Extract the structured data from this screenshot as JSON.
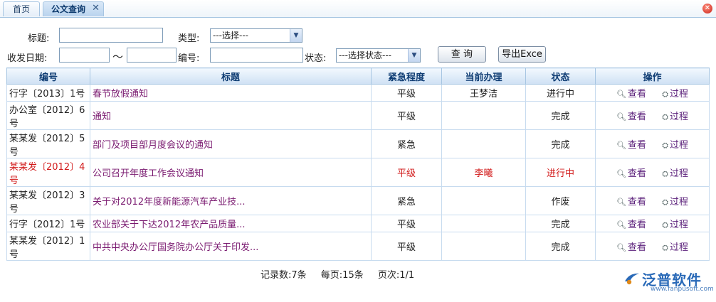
{
  "tabs": [
    {
      "label": "首页",
      "active": false
    },
    {
      "label": "公文查询",
      "active": true,
      "close": "✕"
    }
  ],
  "window_close": "✕",
  "search": {
    "title_label": "标题:",
    "title_value": "",
    "type_label": "类型:",
    "type_selected": "---选择---",
    "date_label": "收发日期:",
    "date_from": "",
    "date_sep": "～",
    "date_to": "",
    "number_label": "编号:",
    "number_value": "",
    "status_label": "状态:",
    "status_selected": "---选择状态---",
    "query_button": "查 询",
    "export_button": "导出Exce"
  },
  "grid": {
    "columns": [
      "编号",
      "标题",
      "紧急程度",
      "当前办理",
      "状态",
      "操作"
    ],
    "view_label": "查看",
    "process_label": "过程",
    "rows": [
      {
        "number": "行字〔2013〕1号",
        "title": "春节放假通知",
        "urgency": "平级",
        "handler": "王梦洁",
        "status": "进行中",
        "highlight": false
      },
      {
        "number": "办公室〔2012〕6号",
        "title": "通知",
        "urgency": "平级",
        "handler": "",
        "status": "完成",
        "highlight": false
      },
      {
        "number": "某某发〔2012〕5号",
        "title": "部门及项目部月度会议的通知",
        "urgency": "紧急",
        "handler": "",
        "status": "完成",
        "highlight": false
      },
      {
        "number": "某某发〔2012〕4号",
        "title": "公司召开年度工作会议通知",
        "urgency": "平级",
        "handler": "李曦",
        "status": "进行中",
        "highlight": true
      },
      {
        "number": "某某发〔2012〕3号",
        "title": "关于对2012年度新能源汽车产业技...",
        "urgency": "紧急",
        "handler": "",
        "status": "作废",
        "highlight": false
      },
      {
        "number": "行字〔2012〕1号",
        "title": "农业部关于下达2012年农产品质量...",
        "urgency": "平级",
        "handler": "",
        "status": "完成",
        "highlight": false
      },
      {
        "number": "某某发〔2012〕1号",
        "title": "中共中央办公厅国务院办公厅关于印发...",
        "urgency": "平级",
        "handler": "",
        "status": "完成",
        "highlight": false
      }
    ]
  },
  "footer": {
    "records": "记录数:7条",
    "per_page": "每页:15条",
    "page": "页次:1/1"
  },
  "brand": {
    "name": "泛普软件",
    "url": "www.fanpusoft.com",
    "color": "#2a6ab8"
  }
}
